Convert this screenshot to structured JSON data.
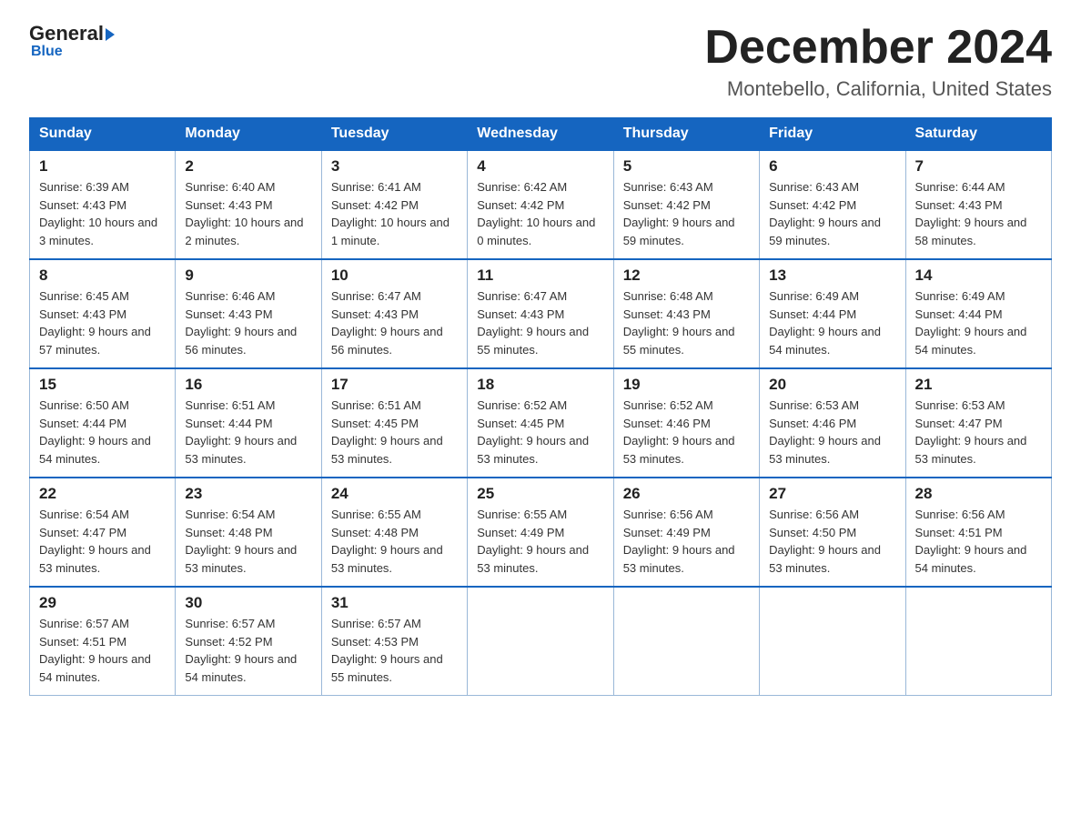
{
  "header": {
    "logo_main": "General",
    "logo_sub": "Blue",
    "main_title": "December 2024",
    "subtitle": "Montebello, California, United States"
  },
  "days_of_week": [
    "Sunday",
    "Monday",
    "Tuesday",
    "Wednesday",
    "Thursday",
    "Friday",
    "Saturday"
  ],
  "weeks": [
    [
      {
        "day": 1,
        "sunrise": "6:39 AM",
        "sunset": "4:43 PM",
        "daylight": "10 hours and 3 minutes."
      },
      {
        "day": 2,
        "sunrise": "6:40 AM",
        "sunset": "4:43 PM",
        "daylight": "10 hours and 2 minutes."
      },
      {
        "day": 3,
        "sunrise": "6:41 AM",
        "sunset": "4:42 PM",
        "daylight": "10 hours and 1 minute."
      },
      {
        "day": 4,
        "sunrise": "6:42 AM",
        "sunset": "4:42 PM",
        "daylight": "10 hours and 0 minutes."
      },
      {
        "day": 5,
        "sunrise": "6:43 AM",
        "sunset": "4:42 PM",
        "daylight": "9 hours and 59 minutes."
      },
      {
        "day": 6,
        "sunrise": "6:43 AM",
        "sunset": "4:42 PM",
        "daylight": "9 hours and 59 minutes."
      },
      {
        "day": 7,
        "sunrise": "6:44 AM",
        "sunset": "4:43 PM",
        "daylight": "9 hours and 58 minutes."
      }
    ],
    [
      {
        "day": 8,
        "sunrise": "6:45 AM",
        "sunset": "4:43 PM",
        "daylight": "9 hours and 57 minutes."
      },
      {
        "day": 9,
        "sunrise": "6:46 AM",
        "sunset": "4:43 PM",
        "daylight": "9 hours and 56 minutes."
      },
      {
        "day": 10,
        "sunrise": "6:47 AM",
        "sunset": "4:43 PM",
        "daylight": "9 hours and 56 minutes."
      },
      {
        "day": 11,
        "sunrise": "6:47 AM",
        "sunset": "4:43 PM",
        "daylight": "9 hours and 55 minutes."
      },
      {
        "day": 12,
        "sunrise": "6:48 AM",
        "sunset": "4:43 PM",
        "daylight": "9 hours and 55 minutes."
      },
      {
        "day": 13,
        "sunrise": "6:49 AM",
        "sunset": "4:44 PM",
        "daylight": "9 hours and 54 minutes."
      },
      {
        "day": 14,
        "sunrise": "6:49 AM",
        "sunset": "4:44 PM",
        "daylight": "9 hours and 54 minutes."
      }
    ],
    [
      {
        "day": 15,
        "sunrise": "6:50 AM",
        "sunset": "4:44 PM",
        "daylight": "9 hours and 54 minutes."
      },
      {
        "day": 16,
        "sunrise": "6:51 AM",
        "sunset": "4:44 PM",
        "daylight": "9 hours and 53 minutes."
      },
      {
        "day": 17,
        "sunrise": "6:51 AM",
        "sunset": "4:45 PM",
        "daylight": "9 hours and 53 minutes."
      },
      {
        "day": 18,
        "sunrise": "6:52 AM",
        "sunset": "4:45 PM",
        "daylight": "9 hours and 53 minutes."
      },
      {
        "day": 19,
        "sunrise": "6:52 AM",
        "sunset": "4:46 PM",
        "daylight": "9 hours and 53 minutes."
      },
      {
        "day": 20,
        "sunrise": "6:53 AM",
        "sunset": "4:46 PM",
        "daylight": "9 hours and 53 minutes."
      },
      {
        "day": 21,
        "sunrise": "6:53 AM",
        "sunset": "4:47 PM",
        "daylight": "9 hours and 53 minutes."
      }
    ],
    [
      {
        "day": 22,
        "sunrise": "6:54 AM",
        "sunset": "4:47 PM",
        "daylight": "9 hours and 53 minutes."
      },
      {
        "day": 23,
        "sunrise": "6:54 AM",
        "sunset": "4:48 PM",
        "daylight": "9 hours and 53 minutes."
      },
      {
        "day": 24,
        "sunrise": "6:55 AM",
        "sunset": "4:48 PM",
        "daylight": "9 hours and 53 minutes."
      },
      {
        "day": 25,
        "sunrise": "6:55 AM",
        "sunset": "4:49 PM",
        "daylight": "9 hours and 53 minutes."
      },
      {
        "day": 26,
        "sunrise": "6:56 AM",
        "sunset": "4:49 PM",
        "daylight": "9 hours and 53 minutes."
      },
      {
        "day": 27,
        "sunrise": "6:56 AM",
        "sunset": "4:50 PM",
        "daylight": "9 hours and 53 minutes."
      },
      {
        "day": 28,
        "sunrise": "6:56 AM",
        "sunset": "4:51 PM",
        "daylight": "9 hours and 54 minutes."
      }
    ],
    [
      {
        "day": 29,
        "sunrise": "6:57 AM",
        "sunset": "4:51 PM",
        "daylight": "9 hours and 54 minutes."
      },
      {
        "day": 30,
        "sunrise": "6:57 AM",
        "sunset": "4:52 PM",
        "daylight": "9 hours and 54 minutes."
      },
      {
        "day": 31,
        "sunrise": "6:57 AM",
        "sunset": "4:53 PM",
        "daylight": "9 hours and 55 minutes."
      },
      null,
      null,
      null,
      null
    ]
  ]
}
